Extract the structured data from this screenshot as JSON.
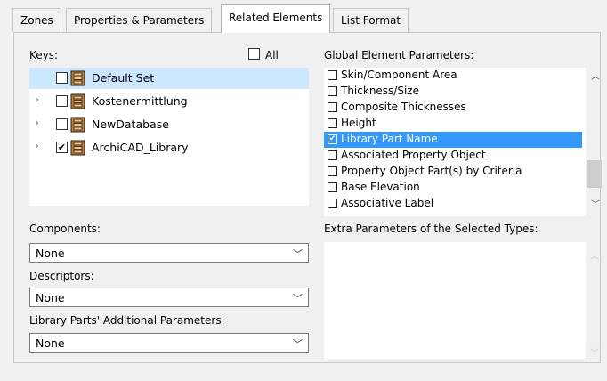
{
  "tabs": [
    {
      "label": "Zones"
    },
    {
      "label": "Properties & Parameters"
    },
    {
      "label": "Related Elements"
    },
    {
      "label": "List Format"
    }
  ],
  "keys": {
    "label": "Keys:",
    "all_label": "All",
    "items": [
      {
        "label": "Default Set",
        "checked": false,
        "selected": true
      },
      {
        "label": "Kostenermittlung",
        "checked": false,
        "selected": false
      },
      {
        "label": "NewDatabase",
        "checked": false,
        "selected": false
      },
      {
        "label": "ArchiCAD_Library",
        "checked": true,
        "selected": false
      }
    ]
  },
  "global_params": {
    "label": "Global Element Parameters:",
    "items": [
      {
        "label": "Skin/Component Area",
        "checked": false
      },
      {
        "label": "Thickness/Size",
        "checked": false
      },
      {
        "label": "Composite Thicknesses",
        "checked": false
      },
      {
        "label": "Height",
        "checked": false
      },
      {
        "label": "Library Part Name",
        "checked": true,
        "selected": true
      },
      {
        "label": "Associated Property Object",
        "checked": false
      },
      {
        "label": "Property Object Part(s) by Criteria",
        "checked": false
      },
      {
        "label": "Base Elevation",
        "checked": false
      },
      {
        "label": "Associative Label",
        "checked": false
      }
    ]
  },
  "components": {
    "label": "Components:",
    "value": "None"
  },
  "descriptors": {
    "label": "Descriptors:",
    "value": "None"
  },
  "library_parts": {
    "label": "Library Parts' Additional Parameters:",
    "value": "None"
  },
  "extra_params": {
    "label": "Extra Parameters of the Selected Types:"
  },
  "colors": {
    "selection": "#3399ff",
    "tree_selection": "#cce8ff"
  }
}
